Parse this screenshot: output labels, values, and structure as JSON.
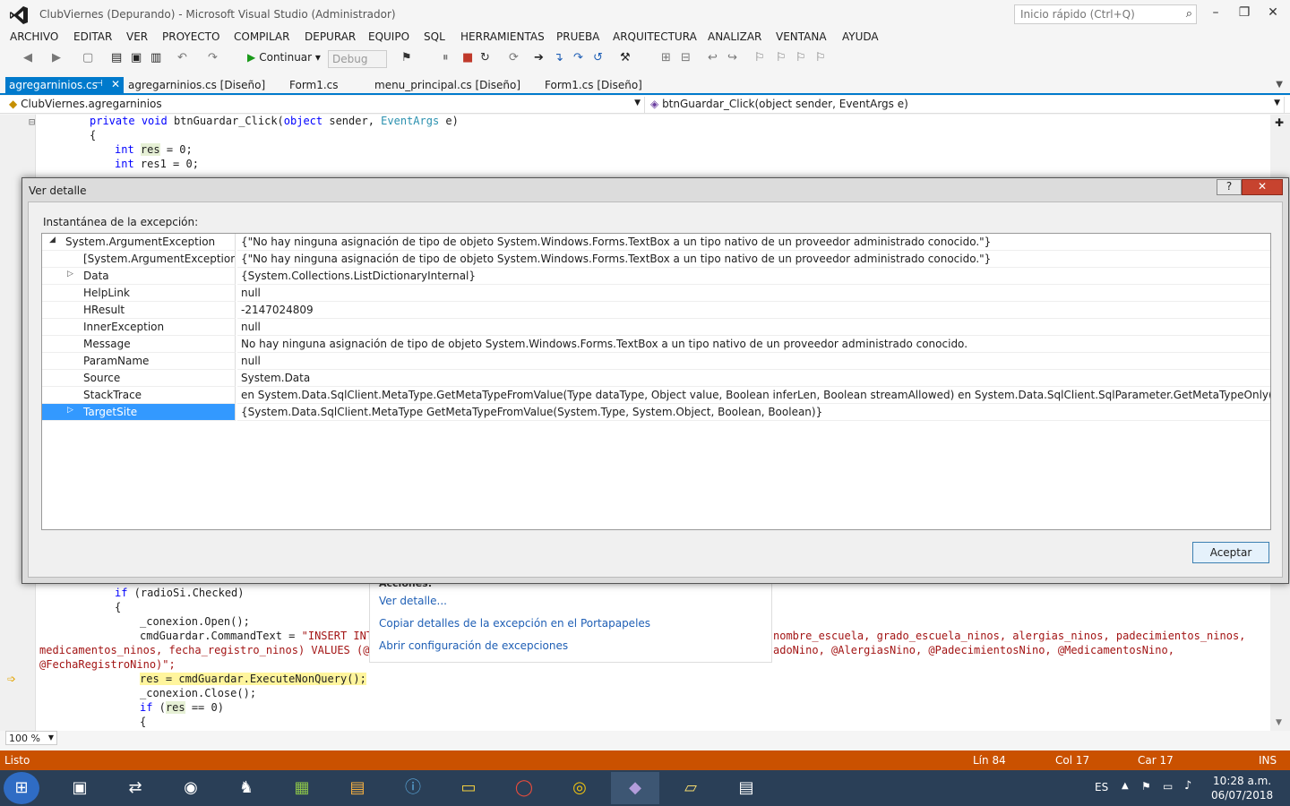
{
  "window": {
    "title": "ClubViernes (Depurando) - Microsoft Visual Studio (Administrador)",
    "quick_launch_placeholder": "Inicio rápido (Ctrl+Q)"
  },
  "menu": [
    "ARCHIVO",
    "EDITAR",
    "VER",
    "PROYECTO",
    "COMPILAR",
    "DEPURAR",
    "EQUIPO",
    "SQL",
    "HERRAMIENTAS",
    "PRUEBA",
    "ARQUITECTURA",
    "ANALIZAR",
    "VENTANA",
    "AYUDA"
  ],
  "toolbar": {
    "continue_label": "Continuar",
    "config": "Debug"
  },
  "tabs": [
    "agregarninios.cs",
    "agregarninios.cs [Diseño]",
    "Form1.cs",
    "menu_principal.cs [Diseño]",
    "Form1.cs [Diseño]"
  ],
  "nav": {
    "class": "ClubViernes.agregarninios",
    "member": "btnGuardar_Click(object sender, EventArgs e)"
  },
  "code": {
    "l1": "{",
    "l2b": "res1 = 0;",
    "if_line": "if (radioSi.Checked)",
    "brace": "{",
    "open": "_conexion.Open();",
    "cmd": "cmdGuardar.CommandText = ",
    "cmd_str": "\"INSERT INTO",
    "cmd_tail": "nombre_escuela, grado_escuela_ninos, alergias_ninos, padecimientos_ninos,",
    "cmd_l2a": "medicamentos_ninos, fecha_registro_ninos) VALUES (@Ni",
    "cmd_l2b": "adoNino, @AlergiasNino, @PadecimientosNino, @MedicamentosNino,",
    "cmd_l3": "@FechaRegistroNino)\";",
    "exec": "res = cmdGuardar.ExecuteNonQuery();",
    "close": "_conexion.Close();",
    "if_res": "if (res == 0)",
    "brace2": "{"
  },
  "exception_helper": {
    "title": "Acciones:",
    "links": [
      "Ver detalle...",
      "Copiar detalles de la excepción en el Portapapeles",
      "Abrir configuración de excepciones"
    ]
  },
  "zoom": "100 %",
  "status": {
    "text": "Listo",
    "line": "Lín 84",
    "col": "Col 17",
    "car": "Car 17",
    "mode": "INS"
  },
  "tray": {
    "lang": "ES",
    "time": "10:28 a.m.",
    "date": "06/07/2018"
  },
  "dialog": {
    "title": "Ver detalle",
    "help": "?",
    "snapshot_label": "Instantánea de la excepción:",
    "ok_label": "Aceptar",
    "rows": [
      {
        "name": "System.ArgumentException",
        "value": "{\"No hay ninguna asignación de tipo de objeto System.Windows.Forms.TextBox a un tipo nativo de un proveedor administrado conocido.\"}"
      },
      {
        "name": "[System.ArgumentException]",
        "value": "{\"No hay ninguna asignación de tipo de objeto System.Windows.Forms.TextBox a un tipo nativo de un proveedor administrado conocido.\"}"
      },
      {
        "name": "Data",
        "value": "{System.Collections.ListDictionaryInternal}"
      },
      {
        "name": "HelpLink",
        "value": "null"
      },
      {
        "name": "HResult",
        "value": "-2147024809"
      },
      {
        "name": "InnerException",
        "value": "null"
      },
      {
        "name": "Message",
        "value": "No hay ninguna asignación de tipo de objeto System.Windows.Forms.TextBox a un tipo nativo de un proveedor administrado conocido."
      },
      {
        "name": "ParamName",
        "value": "null"
      },
      {
        "name": "Source",
        "value": "System.Data"
      },
      {
        "name": "StackTrace",
        "value": "   en System.Data.SqlClient.MetaType.GetMetaTypeFromValue(Type dataType, Object value, Boolean inferLen, Boolean streamAllowed)   en System.Data.SqlClient.SqlParameter.GetMetaTypeOnly()   en System.Data.SqlCl"
      },
      {
        "name": "TargetSite",
        "value": "{System.Data.SqlClient.MetaType GetMetaTypeFromValue(System.Type, System.Object, Boolean, Boolean)}"
      }
    ]
  }
}
